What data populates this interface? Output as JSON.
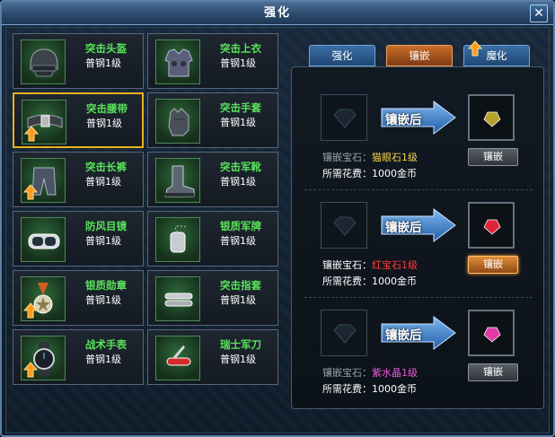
{
  "window": {
    "title": "强化",
    "close_glyph": "✕"
  },
  "equipment": [
    {
      "name": "突击头盔",
      "grade": "普钢1级",
      "icon": "helmet-icon",
      "selected": false,
      "upgradable": false
    },
    {
      "name": "突击上衣",
      "grade": "普钢1级",
      "icon": "armor-vest-icon",
      "selected": false,
      "upgradable": false
    },
    {
      "name": "突击腰带",
      "grade": "普钢1级",
      "icon": "belt-icon",
      "selected": true,
      "upgradable": true
    },
    {
      "name": "突击手套",
      "grade": "普钢1级",
      "icon": "glove-icon",
      "selected": false,
      "upgradable": false
    },
    {
      "name": "突击长裤",
      "grade": "普钢1级",
      "icon": "pants-icon",
      "selected": false,
      "upgradable": true
    },
    {
      "name": "突击军靴",
      "grade": "普钢1级",
      "icon": "boot-icon",
      "selected": false,
      "upgradable": false
    },
    {
      "name": "防风目镜",
      "grade": "普钢1级",
      "icon": "goggles-icon",
      "selected": false,
      "upgradable": false
    },
    {
      "name": "银质军牌",
      "grade": "普钢1级",
      "icon": "dog-tag-icon",
      "selected": false,
      "upgradable": false
    },
    {
      "name": "银质勋章",
      "grade": "普钢1级",
      "icon": "medal-icon",
      "selected": false,
      "upgradable": true
    },
    {
      "name": "突击指套",
      "grade": "普钢1级",
      "icon": "finger-guard-icon",
      "selected": false,
      "upgradable": false
    },
    {
      "name": "战术手表",
      "grade": "普钢1级",
      "icon": "watch-icon",
      "selected": false,
      "upgradable": true
    },
    {
      "name": "瑞士军刀",
      "grade": "普钢1级",
      "icon": "swiss-knife-icon",
      "selected": false,
      "upgradable": false
    }
  ],
  "tabs": [
    {
      "label": "强化",
      "active": false,
      "upgrade_arrow": false
    },
    {
      "label": "镶嵌",
      "active": true,
      "upgrade_arrow": false
    },
    {
      "label": "魔化",
      "active": false,
      "upgrade_arrow": true
    }
  ],
  "inlay_rows": [
    {
      "arrow_label": "镶嵌后",
      "gem_prefix": "镶嵌宝石：",
      "gem_name": "猫眼石1级",
      "gem_color": "#f0d24a",
      "cost_text": "所需花费：1000金币",
      "button_label": "镶嵌",
      "button_active": false,
      "label_lit": false,
      "result_gem_color": "#b8a12a",
      "result_gem_icon": "cats-eye-gem-icon"
    },
    {
      "arrow_label": "镶嵌后",
      "gem_prefix": "镶嵌宝石：",
      "gem_name": "红宝石1级",
      "gem_color": "#ff3b3b",
      "cost_text": "所需花费：1000金币",
      "button_label": "镶嵌",
      "button_active": true,
      "label_lit": true,
      "result_gem_color": "#e0243a",
      "result_gem_icon": "ruby-gem-icon"
    },
    {
      "arrow_label": "镶嵌后",
      "gem_prefix": "镶嵌宝石：",
      "gem_name": "紫水晶1级",
      "gem_color": "#e85ad8",
      "cost_text": "所需花费：1000金币",
      "button_label": "镶嵌",
      "button_active": false,
      "label_lit": false,
      "result_gem_color": "#e23aa6",
      "result_gem_icon": "amethyst-gem-icon"
    }
  ],
  "colors": {
    "item_name": "#59e35a",
    "selected_border": "#e8b21c",
    "tab_active": "#c96d2a",
    "tab_inactive": "#2f5f92"
  }
}
